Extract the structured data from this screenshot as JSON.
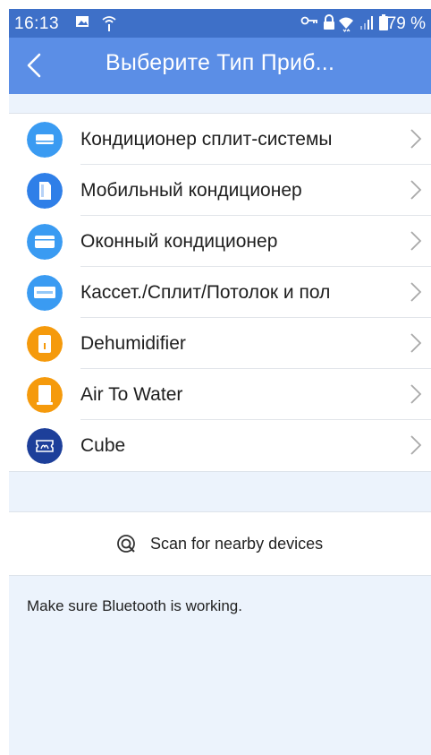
{
  "status_bar": {
    "time": "16:13",
    "battery": "79 %",
    "icons": [
      "image-icon",
      "wifi-alert-icon",
      "key-icon",
      "lock-icon",
      "wifi-icon",
      "signal-icon",
      "battery-icon"
    ]
  },
  "app_bar": {
    "title": "Выберите Тип Приб..."
  },
  "devices": [
    {
      "label": "Кондиционер сплит-системы",
      "icon": "split-ac-icon",
      "color": "#3a9bf2"
    },
    {
      "label": "Мобильный кондиционер",
      "icon": "portable-ac-icon",
      "color": "#2f7fe8"
    },
    {
      "label": "Оконный кондиционер",
      "icon": "window-ac-icon",
      "color": "#3a9bf2"
    },
    {
      "label": "Кассет./Сплит/Потолок и пол",
      "icon": "cassette-ac-icon",
      "color": "#3a9bf2"
    },
    {
      "label": "Dehumidifier",
      "icon": "dehumidifier-icon",
      "color": "#f59a0c"
    },
    {
      "label": "Air To Water",
      "icon": "air-to-water-icon",
      "color": "#f59a0c"
    },
    {
      "label": "Cube",
      "icon": "cube-icon",
      "color": "#1d3f9a"
    }
  ],
  "scan": {
    "label": "Scan for nearby devices"
  },
  "hint": "Make sure Bluetooth is working.",
  "colors": {
    "status_bar": "#3e70c8",
    "app_bar": "#5b8ee6",
    "background": "#ecf3fc"
  }
}
